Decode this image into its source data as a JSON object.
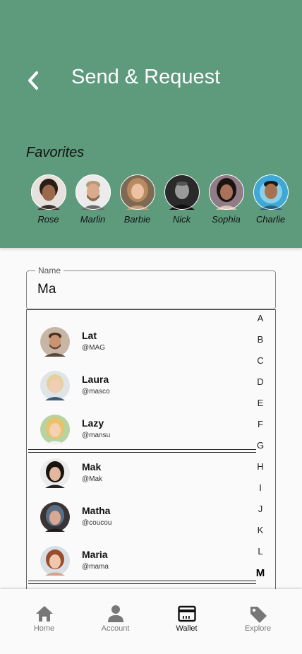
{
  "header": {
    "title": "Send & Request",
    "favorites_heading": "Favorites",
    "favorites": [
      {
        "name": "Rose"
      },
      {
        "name": "Marlin"
      },
      {
        "name": "Barbie"
      },
      {
        "name": "Nick"
      },
      {
        "name": "Sophia"
      },
      {
        "name": "Charlie"
      }
    ]
  },
  "search": {
    "label": "Name",
    "value": "Ma"
  },
  "contacts": [
    {
      "name": "Lat",
      "handle": "@MAG"
    },
    {
      "name": "Laura",
      "handle": "@masco"
    },
    {
      "name": "Lazy",
      "handle": "@mansu"
    },
    {
      "name": "Mak",
      "handle": "@Mak"
    },
    {
      "name": "Matha",
      "handle": "@coucou"
    },
    {
      "name": "Maria",
      "handle": "@mama"
    }
  ],
  "alphabet": [
    "A",
    "B",
    "C",
    "D",
    "E",
    "F",
    "G",
    "H",
    "I",
    "J",
    "K",
    "L",
    "M"
  ],
  "alphabet_active": "M",
  "nav": [
    {
      "label": "Home",
      "icon": "home-icon"
    },
    {
      "label": "Account",
      "icon": "account-icon"
    },
    {
      "label": "Wallet",
      "icon": "wallet-icon"
    },
    {
      "label": "Explore",
      "icon": "tag-icon"
    }
  ],
  "nav_active": "Wallet",
  "colors": {
    "header_bg": "#5e9b7c",
    "title_text": "#ffffff"
  }
}
